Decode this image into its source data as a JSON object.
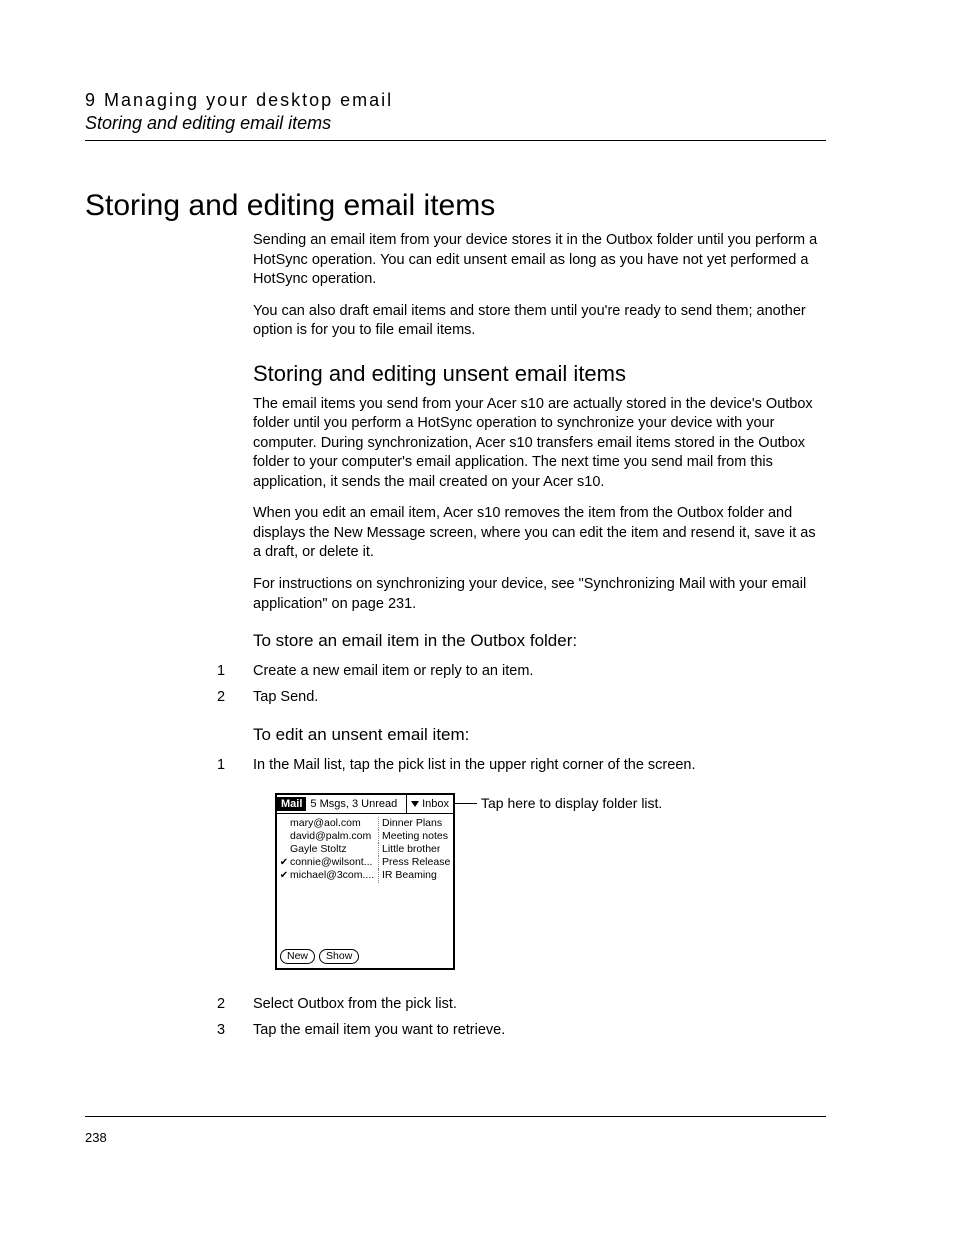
{
  "header": {
    "chapter_line": "9  Managing your desktop email",
    "section_line": "Storing and editing email items"
  },
  "main_heading": "Storing and editing email items",
  "intro_paras": [
    "Sending an email item from your device stores it in the Outbox folder until you perform a HotSync operation. You can edit unsent email as long as you have not yet performed a HotSync operation.",
    "You can also draft email items and store them until you're ready to send them; another option is for you to file email items."
  ],
  "section1": {
    "heading": "Storing and editing unsent email items",
    "paras": [
      "The email items you send from your Acer s10 are actually stored in the device's Outbox folder until you perform a HotSync operation to synchronize your device with your computer. During synchronization, Acer s10 transfers email items stored in the Outbox folder to your computer's email application. The next time you send mail from this application, it sends the mail created on your Acer s10.",
      "When you edit an email item, Acer s10 removes the item from the Outbox folder and displays the New Message screen, where you can edit the item and resend it, save it as a draft, or delete it.",
      "For instructions on synchronizing your device, see \"Synchronizing Mail with your email application\" on page 231."
    ]
  },
  "task1": {
    "heading": "To store an email item in the Outbox folder:",
    "steps": [
      {
        "num": "1",
        "text": "Create a new email item or reply to an item."
      },
      {
        "num": "2",
        "text": "Tap Send."
      }
    ]
  },
  "task2": {
    "heading": "To edit an unsent email item:",
    "steps_before": [
      {
        "num": "1",
        "text": "In the Mail list, tap the pick list in the upper right corner of the screen."
      }
    ],
    "steps_after": [
      {
        "num": "2",
        "text": "Select Outbox from the pick list."
      },
      {
        "num": "3",
        "text": "Tap the email item you want to retrieve."
      }
    ]
  },
  "device_shot": {
    "app_label": "Mail",
    "status": "5 Msgs, 3 Unread",
    "folder": "Inbox",
    "messages": [
      {
        "check": "",
        "from": "mary@aol.com",
        "subject": "Dinner Plans"
      },
      {
        "check": "",
        "from": "david@palm.com",
        "subject": "Meeting notes"
      },
      {
        "check": "",
        "from": "Gayle Stoltz",
        "subject": "Little brother"
      },
      {
        "check": "✔",
        "from": "connie@wilsont...",
        "subject": "Press Release"
      },
      {
        "check": "✔",
        "from": "michael@3com....",
        "subject": "IR Beaming"
      }
    ],
    "buttons": {
      "new": "New",
      "show": "Show"
    }
  },
  "callout_text": "Tap here to display folder list.",
  "page_number": "238"
}
